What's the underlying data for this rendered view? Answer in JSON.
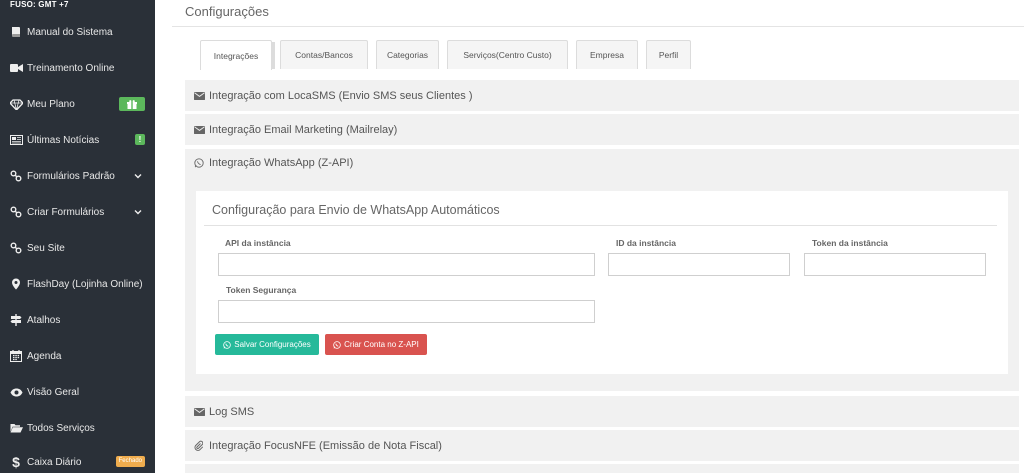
{
  "sidebar": {
    "timezone": "FUSO: GMT +7",
    "items": [
      {
        "label": "Manual do Sistema",
        "icon": "book-icon"
      },
      {
        "label": "Treinamento Online",
        "icon": "video-camera-icon"
      },
      {
        "label": "Meu Plano",
        "icon": "diamond-icon",
        "badge": "gift-icon"
      },
      {
        "label": "Últimas Notícias",
        "icon": "newspaper-icon",
        "badge_text": "!"
      },
      {
        "label": "Formulários Padrão",
        "icon": "link-icon"
      },
      {
        "label": "Criar Formulários",
        "icon": "link-icon"
      },
      {
        "label": "Seu Site",
        "icon": "link-icon"
      },
      {
        "label": "FlashDay (Lojinha Online)",
        "icon": "map-marker-icon"
      },
      {
        "label": "Atalhos",
        "icon": "signpost-icon"
      },
      {
        "label": "Agenda",
        "icon": "calendar-icon"
      },
      {
        "label": "Visão Geral",
        "icon": "eye-icon"
      },
      {
        "label": "Todos Serviços",
        "icon": "folder-open-icon"
      },
      {
        "label": "Caixa Diário",
        "icon": "dollar-icon",
        "badge_text": "Fechado"
      }
    ]
  },
  "page": {
    "title": "Configurações"
  },
  "tabs": [
    "Integrações",
    "Contas/Bancos",
    "Categorias",
    "Serviços(Centro Custo)",
    "Empresa",
    "Perfil"
  ],
  "sections": {
    "locasms": "Integração com LocaSMS (Envio SMS seus Clientes )",
    "mailrelay": "Integração Email Marketing (Mailrelay)",
    "whatsapp": "Integração WhatsApp (Z-API)",
    "logsms": "Log SMS",
    "focusnfe": "Integração FocusNFE (Emissão de Nota Fiscal)"
  },
  "whatsapp_form": {
    "title": "Configuração para Envio de WhatsApp Automáticos",
    "api_label": "API da instância",
    "api_value": "",
    "id_label": "ID da instância",
    "id_value": "",
    "token_label": "Token da instância",
    "token_value": "",
    "security_label": "Token Segurança",
    "security_value": "",
    "save_button": "Salvar Configurações",
    "create_button": "Criar Conta no Z-API"
  },
  "colors": {
    "sidebar_bg": "#2a3038",
    "accent_green": "#26b99a",
    "accent_red": "#d9534f",
    "badge_green": "#5cb85c",
    "badge_orange": "#f0ad4e"
  }
}
